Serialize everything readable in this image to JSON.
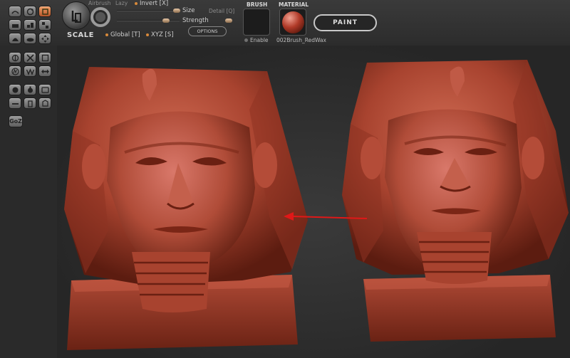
{
  "toolbar": {
    "scale_label": "SCALE",
    "airbrush_label": "Airbrush",
    "lazy_label": "Lazy",
    "invert_label": "Invert [X]",
    "size_label": "Size",
    "detail_label": "Detail [Q]",
    "strength_label": "Strength",
    "options_label": "OPTIONS",
    "global_label": "Global [T]",
    "xyz_label": "XYZ [S]"
  },
  "brush": {
    "section_label": "BRUSH",
    "enable_label": "Enable"
  },
  "material": {
    "section_label": "MATERIAL",
    "name": "002Brush_RedWax"
  },
  "paint_button_label": "PAINT",
  "goz_label": "GoZ",
  "colors": {
    "wax": "#a8432f",
    "accent_orange": "#d98a3a",
    "arrow": "#e01818",
    "background": "#2a2a2a"
  },
  "tool_icons": [
    "sculpt-icon",
    "rotate-icon",
    "scale-icon",
    "mask-icon",
    "stroke-icon",
    "layer-icon",
    "clay-icon",
    "smooth-icon",
    "move-icon",
    "flatten-icon",
    "inflate-icon",
    "pinch-icon",
    "symmetry-icon",
    "clip-icon",
    "frame-icon",
    "curve-icon",
    "zigzag-icon",
    "transpose-icon",
    "material-icon",
    "color-icon",
    "render-icon",
    "undo-icon",
    "redo-icon",
    "save-icon"
  ]
}
